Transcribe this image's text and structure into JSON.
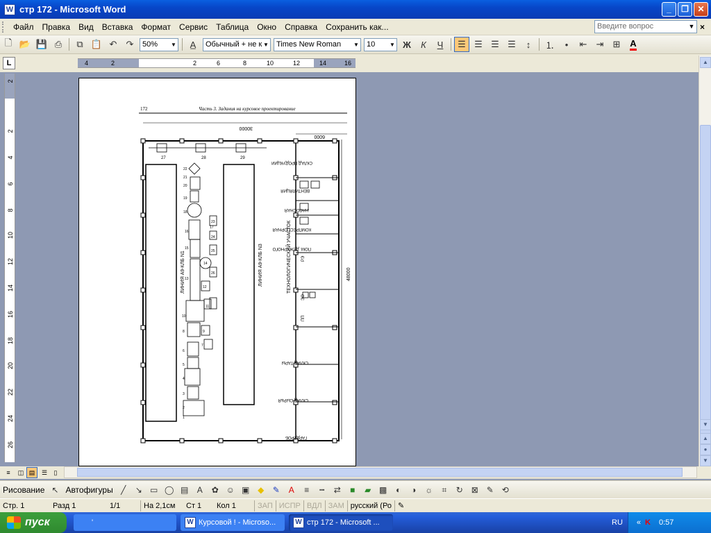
{
  "window": {
    "title": "стр 172 - Microsoft Word",
    "app_icon": "W"
  },
  "menu": {
    "items": [
      "Файл",
      "Правка",
      "Вид",
      "Вставка",
      "Формат",
      "Сервис",
      "Таблица",
      "Окно",
      "Справка",
      "Сохранить как..."
    ],
    "ask_placeholder": "Введите вопрос"
  },
  "toolbar": {
    "zoom": "50%",
    "style": "Обычный + не к",
    "font": "Times New Roman",
    "size": "10",
    "bold": "Ж",
    "italic": "К",
    "underline": "Ч",
    "font_color_label": "A"
  },
  "ruler": {
    "h_numbers": [
      "4",
      "2",
      "2",
      "6",
      "8",
      "10",
      "12",
      "14",
      "16"
    ],
    "v_numbers": [
      "2",
      "2",
      "4",
      "6",
      "8",
      "10",
      "12",
      "14",
      "16",
      "18",
      "20",
      "22",
      "24",
      "26"
    ]
  },
  "page": {
    "header_page": "172",
    "header_title": "Часть 3. Задания на курсовое проектирование",
    "dim_top": "30000",
    "dim_right_top": "6000",
    "dim_side": "48000",
    "line1": "ЛИНИЯ А9-КЛБ N1",
    "line3": "ЛИНИЯ А9-КЛБ N3",
    "tech": "ТЕХНОЛОГИЧЕСКИЙ УЧАСТОК",
    "rooms": [
      "СКЛАД ПРОДУКЦИИ",
      "ВЕНТИЛЯЦИЯ",
      "НАСОСНАЯ",
      "КОМПРЕССОРНАЯ",
      "ПОМ. ДЕЖУРНОГО",
      "СКЛАД ТАРЫ",
      "СКЛАД СЫРЬЯ",
      "ГАРДЕРОБ"
    ],
    "room_codes": [
      "РЭ",
      "ЭО",
      "ПП"
    ],
    "equip_numbers": [
      "1",
      "2",
      "3",
      "4",
      "5",
      "6",
      "7",
      "8",
      "9",
      "10",
      "11",
      "12",
      "13",
      "14",
      "15",
      "16",
      "17",
      "18",
      "19",
      "20",
      "21",
      "22",
      "23",
      "24",
      "25",
      "26",
      "27",
      "28",
      "29"
    ]
  },
  "drawbar": {
    "drawing": "Рисование",
    "autoshapes": "Автофигуры"
  },
  "status": {
    "page": "Стр. 1",
    "section": "Разд 1",
    "pages": "1/1",
    "at": "На 2,1см",
    "line": "Ст 1",
    "col": "Кол 1",
    "rec": "ЗАП",
    "trk": "ИСПР",
    "ext": "ВДЛ",
    "ovr": "ЗАМ",
    "lang": "русский (Ро"
  },
  "taskbar": {
    "start": "пуск",
    "tasks": [
      "'",
      "Курсовой ! - Microso...",
      "стр 172 - Microsoft ..."
    ],
    "lang": "RU",
    "time": "0:57"
  }
}
